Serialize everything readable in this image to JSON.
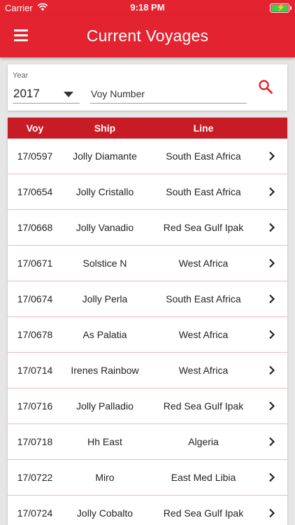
{
  "status_bar": {
    "carrier": "Carrier",
    "time": "9:18 PM"
  },
  "app_bar": {
    "title": "Current Voyages"
  },
  "search": {
    "year_label": "Year",
    "year_value": "2017",
    "voy_placeholder": "Voy Number"
  },
  "table": {
    "headers": {
      "voy": "Voy",
      "ship": "Ship",
      "line": "Line"
    },
    "rows": [
      {
        "voy": "17/0597",
        "ship": "Jolly Diamante",
        "line": "South East Africa"
      },
      {
        "voy": "17/0654",
        "ship": "Jolly Cristallo",
        "line": "South East Africa"
      },
      {
        "voy": "17/0668",
        "ship": "Jolly Vanadio",
        "line": "Red Sea Gulf Ipak"
      },
      {
        "voy": "17/0671",
        "ship": "Solstice N",
        "line": "West Africa"
      },
      {
        "voy": "17/0674",
        "ship": "Jolly Perla",
        "line": "South East Africa"
      },
      {
        "voy": "17/0678",
        "ship": "As Palatia",
        "line": "West Africa"
      },
      {
        "voy": "17/0714",
        "ship": "Irenes Rainbow",
        "line": "West Africa"
      },
      {
        "voy": "17/0716",
        "ship": "Jolly Palladio",
        "line": "Red Sea Gulf Ipak"
      },
      {
        "voy": "17/0718",
        "ship": "Hh East",
        "line": "Algeria"
      },
      {
        "voy": "17/0722",
        "ship": "Miro",
        "line": "East Med Libia"
      },
      {
        "voy": "17/0724",
        "ship": "Jolly Cobalto",
        "line": "Red Sea Gulf Ipak"
      }
    ]
  },
  "colors": {
    "brand_red": "#e3232f",
    "header_red": "#c71c26",
    "divider_pink": "#f2b8bd",
    "battery_green": "#3ecf4a"
  },
  "icons": {
    "menu": "hamburger-icon",
    "search": "search-icon",
    "row_action": "chevron-right-icon",
    "wifi": "wifi-icon",
    "battery": "battery-charging-icon"
  }
}
